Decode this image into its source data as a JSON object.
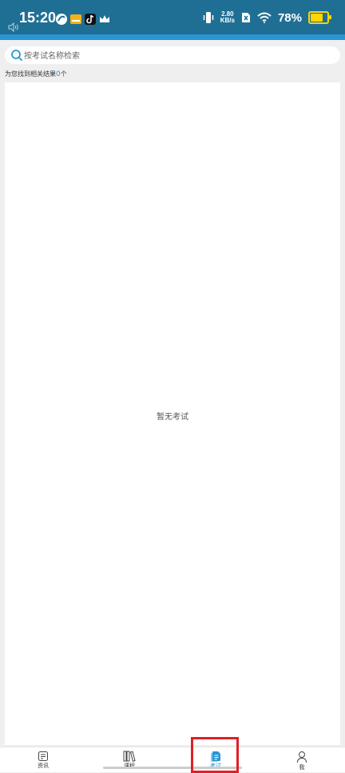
{
  "status_bar": {
    "time": "15:20",
    "net_speed_value": "2.80",
    "net_speed_unit": "KB/s",
    "battery_percent": "78%",
    "battery_color": "#ffd400",
    "bar_color": "#1f6f95",
    "accent_color": "#2a95d4"
  },
  "search": {
    "placeholder": "按考试名称检索"
  },
  "result": {
    "prefix": "为您找到相关结果",
    "count": "0",
    "suffix": "个"
  },
  "empty_state": {
    "message": "暂无考试"
  },
  "tabs": [
    {
      "label": "资讯",
      "icon": "news-icon"
    },
    {
      "label": "课程",
      "icon": "books-icon"
    },
    {
      "label": "考试",
      "icon": "exam-document-icon",
      "active": true
    },
    {
      "label": "我",
      "icon": "profile-icon"
    }
  ],
  "colors": {
    "active": "#2a95d4",
    "highlight": "#e01f26"
  }
}
